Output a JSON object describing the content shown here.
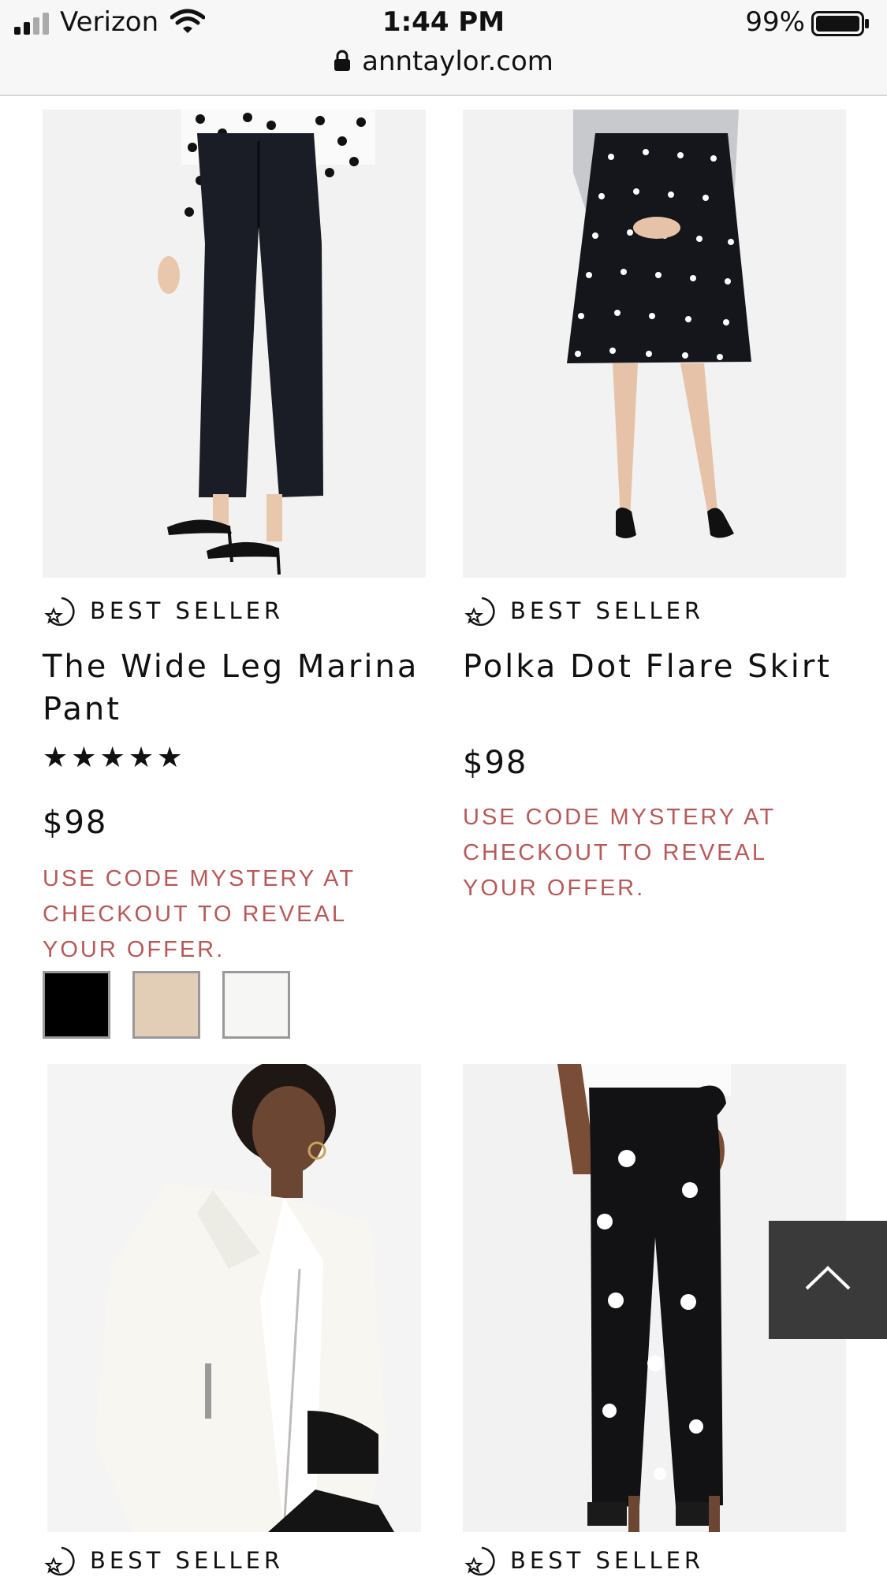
{
  "status_bar": {
    "carrier": "Verizon",
    "time": "1:44 PM",
    "battery_percent": "99%"
  },
  "address_bar": {
    "url": "anntaylor.com"
  },
  "products": [
    {
      "badge": "BEST SELLER",
      "name": "The Wide Leg Marina Pant",
      "rating_stars": "★★★★★",
      "rating": 5,
      "price": "$98",
      "promo": "USE CODE MYSTERY AT CHECKOUT TO REVEAL YOUR OFFER.",
      "swatches": [
        "#000000",
        "#e2cdb6",
        "#f6f6f4"
      ]
    },
    {
      "badge": "BEST SELLER",
      "name": "Polka Dot Flare Skirt",
      "price": "$98",
      "promo": "USE CODE MYSTERY AT CHECKOUT TO REVEAL YOUR OFFER."
    },
    {
      "badge": "BEST SELLER"
    },
    {
      "badge": "BEST SELLER"
    }
  ],
  "colors": {
    "promo_text": "#b65a59",
    "back_to_top_bg": "#3a3a3a"
  },
  "icons": [
    "signal-icon",
    "wifi-icon",
    "battery-icon",
    "lock-icon",
    "best-seller-icon",
    "chevron-up-icon"
  ]
}
